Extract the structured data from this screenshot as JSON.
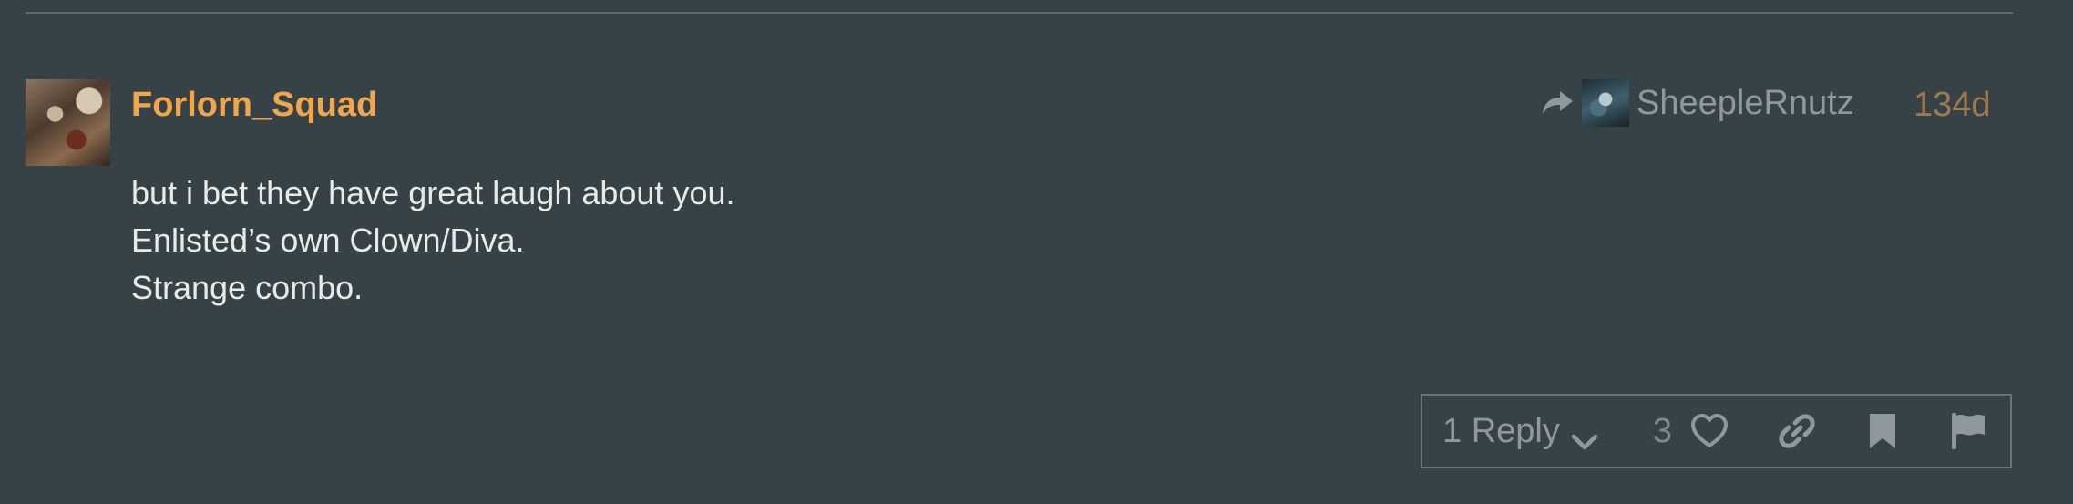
{
  "post": {
    "username": "Forlorn_Squad",
    "reply_to": {
      "name": "SheepleRnutz",
      "icon": "reply-share-arrow-icon"
    },
    "date": "134d",
    "body_lines": [
      "but i bet they have great laugh about you.",
      "Enlisted’s own Clown/Diva.",
      "Strange combo."
    ]
  },
  "actions": {
    "replies_label": "1 Reply",
    "like_count": "3",
    "icons": [
      "chevron-down-icon",
      "heart-icon",
      "link-icon",
      "bookmark-icon",
      "flag-icon"
    ]
  },
  "colors": {
    "background": "#374246",
    "username": "#f0a64d",
    "body_text": "#e7eaea",
    "muted": "#8f999b",
    "date": "#9e7a4f"
  }
}
